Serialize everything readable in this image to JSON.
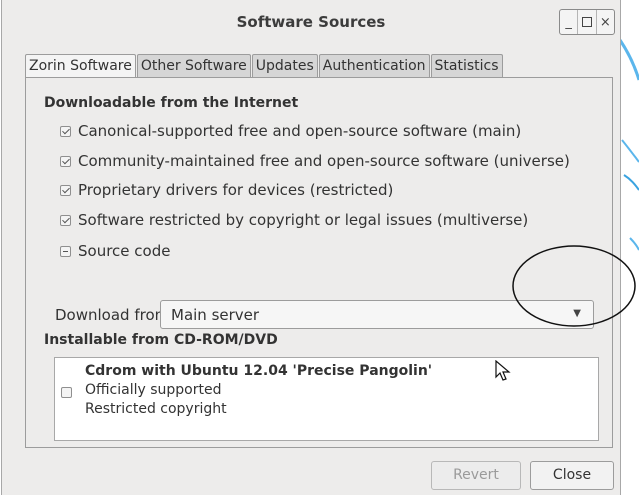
{
  "window": {
    "title": "Software Sources",
    "controls": {
      "minimize": "_",
      "maximize": "□",
      "close": "×"
    }
  },
  "tabs": [
    "Zorin Software",
    "Other Software",
    "Updates",
    "Authentication",
    "Statistics"
  ],
  "internet": {
    "heading": "Downloadable from the Internet",
    "options": [
      {
        "label": "Canonical-supported free and open-source software (main)",
        "state": "checked"
      },
      {
        "label": "Community-maintained free and open-source software (universe)",
        "state": "checked"
      },
      {
        "label": "Proprietary drivers for devices (restricted)",
        "state": "checked"
      },
      {
        "label": "Software restricted by copyright or legal issues (multiverse)",
        "state": "checked"
      },
      {
        "label": "Source code",
        "state": "inconsistent"
      }
    ],
    "download_label": "Download from:",
    "download_value": "Main server"
  },
  "cdrom": {
    "heading": "Installable from CD-ROM/DVD",
    "title": "Cdrom with Ubuntu 12.04 'Precise Pangolin'",
    "line1": "Officially supported",
    "line2": "Restricted copyright",
    "checked": false
  },
  "buttons": {
    "revert": "Revert",
    "close": "Close"
  },
  "colors": {
    "window_bg": "#edeceb",
    "active_tab": "#f4f4f4",
    "inactive_tab": "#d6d6d6",
    "deco_blue": "#3aa3e0"
  }
}
